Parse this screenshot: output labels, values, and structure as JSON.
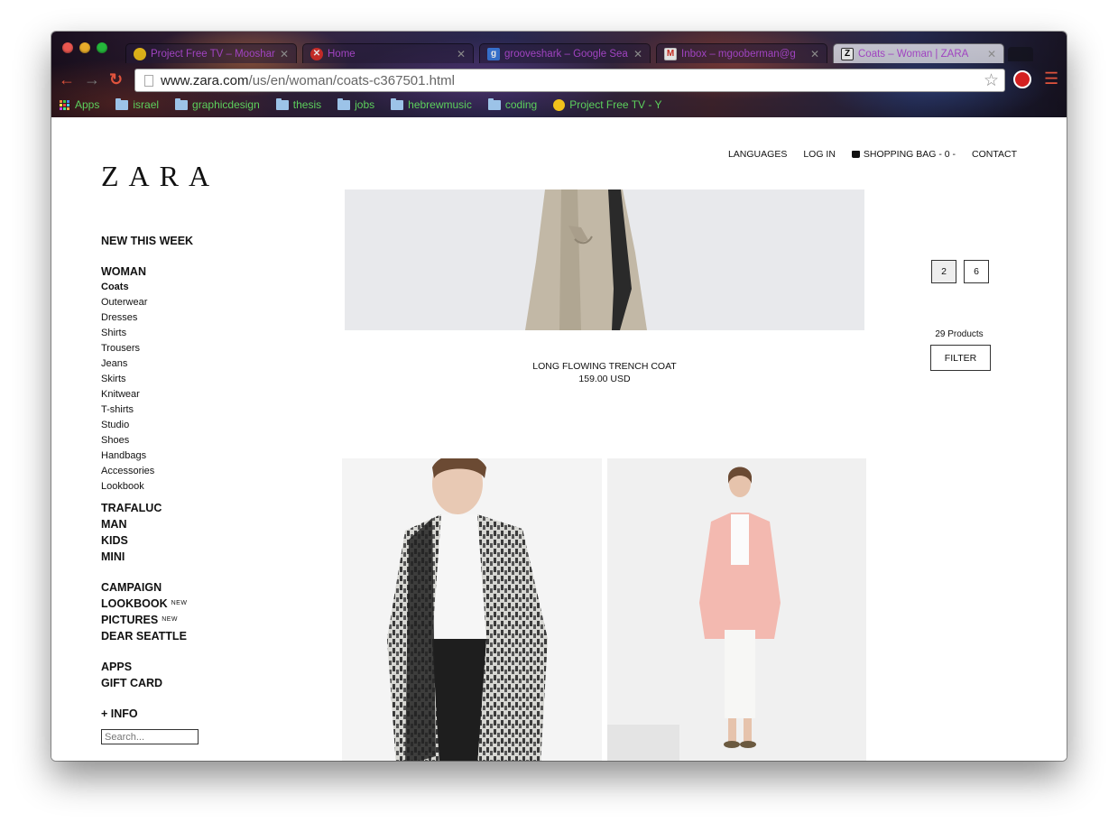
{
  "browser": {
    "tabs": [
      {
        "title": "Project Free TV – Mooshar",
        "favicon": "sun-icon",
        "active": false
      },
      {
        "title": "Home",
        "favicon": "error-x-icon",
        "active": false
      },
      {
        "title": "grooveshark – Google Sea",
        "favicon": "google-icon",
        "active": false
      },
      {
        "title": "Inbox – mgooberman@g",
        "favicon": "gmail-icon",
        "active": false
      },
      {
        "title": "Coats – Woman | ZARA",
        "favicon": "zara-z-icon",
        "active": true
      }
    ],
    "url_host": "www.zara.com",
    "url_path": "/us/en/woman/coats-c367501.html",
    "bookmarks": [
      "Apps",
      "israel",
      "graphicdesign",
      "thesis",
      "jobs",
      "hebrewmusic",
      "coding",
      "Project Free TV - Y"
    ]
  },
  "header": {
    "logo": "ZARA",
    "nav": [
      "LANGUAGES",
      "LOG IN",
      "SHOPPING BAG - 0 -",
      "CONTACT"
    ]
  },
  "sidebar": {
    "new_this_week": "NEW THIS WEEK",
    "woman": "WOMAN",
    "woman_items": [
      "Coats",
      "Outerwear",
      "Dresses",
      "Shirts",
      "Trousers",
      "Jeans",
      "Skirts",
      "Knitwear",
      "T-shirts",
      "Studio",
      "Shoes",
      "Handbags",
      "Accessories",
      "Lookbook"
    ],
    "selected": "Coats",
    "sections1": [
      "TRAFALUC",
      "MAN",
      "KIDS",
      "MINI"
    ],
    "campaign": "CAMPAIGN",
    "lookbook": "LOOKBOOK",
    "pictures": "PICTURES",
    "new_badge": "NEW",
    "dear_seattle": "DEAR SEATTLE",
    "apps": "APPS",
    "gift_card": "GIFT CARD",
    "info": "+ INFO",
    "search_placeholder": "Search..."
  },
  "products": {
    "featured": {
      "name": "LONG FLOWING TRENCH COAT",
      "price": "159.00 USD"
    }
  },
  "listing": {
    "view_options": [
      "2",
      "6"
    ],
    "selected_view": "2",
    "count": "29 Products",
    "filter": "FILTER"
  }
}
